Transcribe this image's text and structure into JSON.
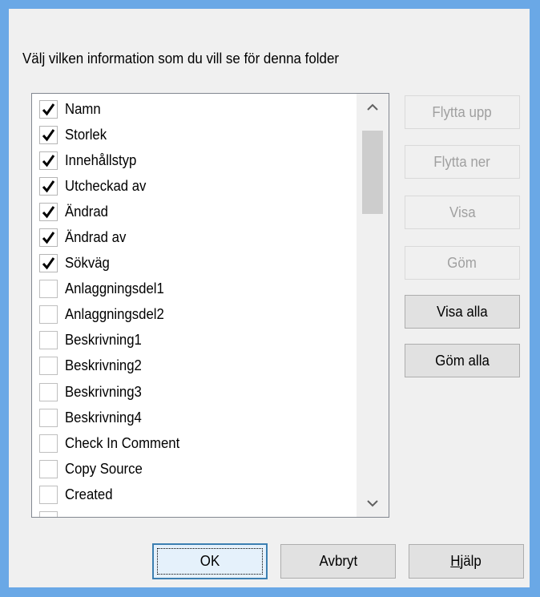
{
  "dialog": {
    "prompt": "Välj vilken information som du vill se för denna folder"
  },
  "columns": [
    {
      "label": "Namn",
      "checked": true
    },
    {
      "label": "Storlek",
      "checked": true
    },
    {
      "label": "Innehållstyp",
      "checked": true
    },
    {
      "label": "Utcheckad av",
      "checked": true
    },
    {
      "label": "Ändrad",
      "checked": true
    },
    {
      "label": "Ändrad av",
      "checked": true
    },
    {
      "label": "Sökväg",
      "checked": true
    },
    {
      "label": "Anlaggningsdel1",
      "checked": false
    },
    {
      "label": "Anlaggningsdel2",
      "checked": false
    },
    {
      "label": "Beskrivning1",
      "checked": false
    },
    {
      "label": "Beskrivning2",
      "checked": false
    },
    {
      "label": "Beskrivning3",
      "checked": false
    },
    {
      "label": "Beskrivning4",
      "checked": false
    },
    {
      "label": "Check In Comment",
      "checked": false
    },
    {
      "label": "Copy Source",
      "checked": false
    },
    {
      "label": "Created",
      "checked": false
    },
    {
      "label": "",
      "checked": false
    }
  ],
  "side_buttons": {
    "move_up": "Flytta upp",
    "move_down": "Flytta ner",
    "show": "Visa",
    "hide": "Göm",
    "show_all": "Visa alla",
    "hide_all": "Göm alla"
  },
  "footer_buttons": {
    "ok": "OK",
    "cancel": "Avbryt",
    "help_prefix": "H",
    "help_rest": "jälp"
  },
  "icons": {
    "scroll_up": "chevron-up-icon",
    "scroll_down": "chevron-down-icon",
    "check": "checkmark-icon"
  },
  "colors": {
    "window_frame": "#6aa8e6",
    "dialog_bg": "#f0f0f0",
    "default_button_border": "#3c7fb1",
    "disabled_text": "#a0a0a0"
  }
}
